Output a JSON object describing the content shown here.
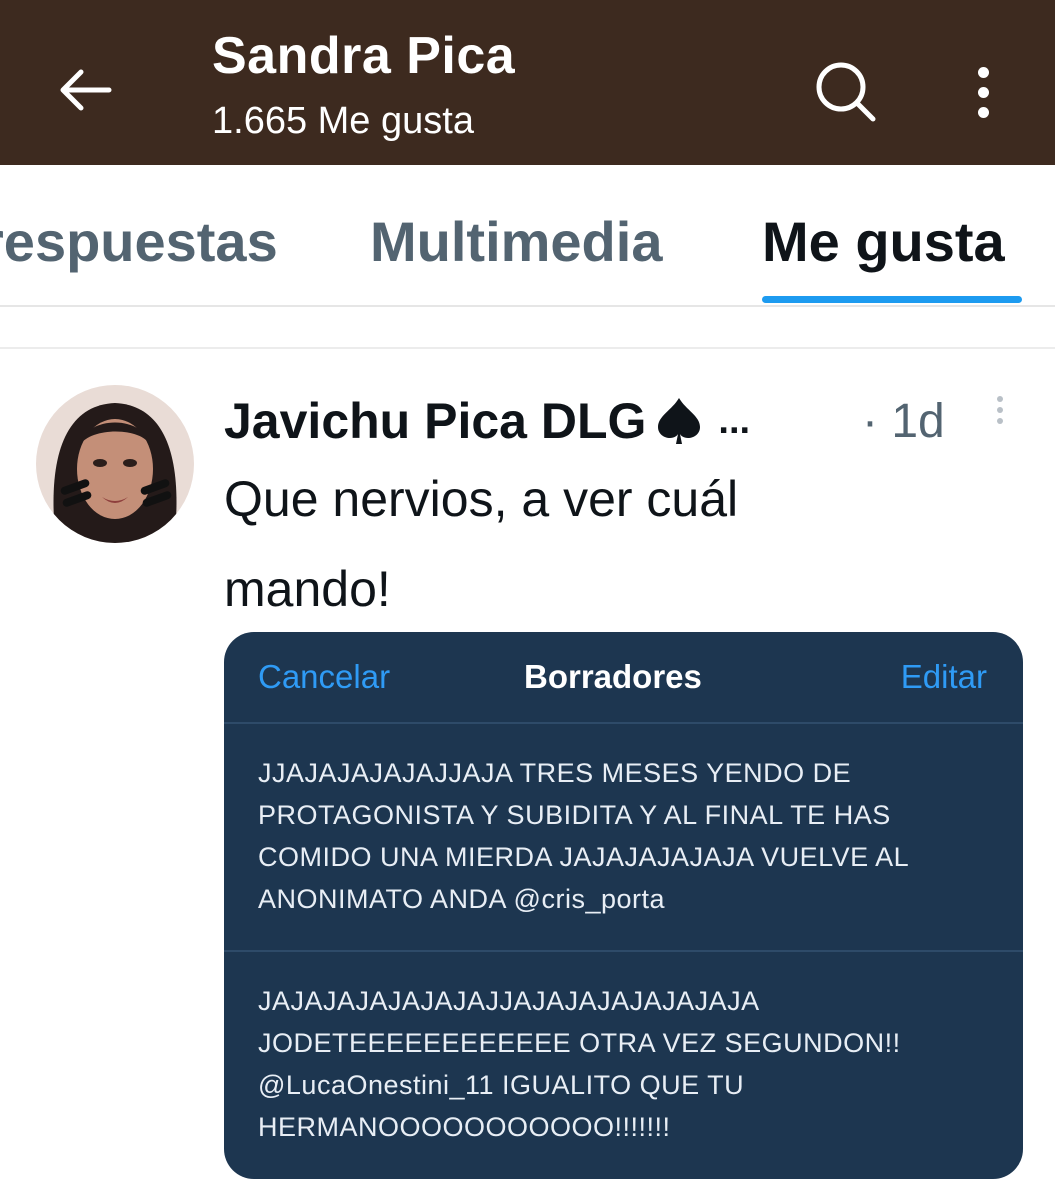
{
  "header": {
    "title": "Sandra Pica",
    "subtitle": "1.665 Me gusta",
    "background_color": "#3d2a1f",
    "icons": [
      "back-arrow-icon",
      "search-icon",
      "more-vertical-icon"
    ]
  },
  "tabs": [
    {
      "label": "respuestas",
      "selected": false
    },
    {
      "label": "Multimedia",
      "selected": false
    },
    {
      "label": "Me gusta",
      "selected": true
    }
  ],
  "accent_color": "#1d9bf0",
  "tweet": {
    "author": "Javichu Pica DLG",
    "author_badge": "spade-icon",
    "truncation": "...",
    "time": "· 1d",
    "text_lines": [
      "Que nervios, a ver cuál",
      "mando!"
    ],
    "drafts_card": {
      "cancel_label": "Cancelar",
      "title": "Borradores",
      "edit_label": "Editar",
      "drafts": [
        {
          "lines": [
            "JJAJAJAJAJAJJAJA TRES MESES YENDO DE",
            "PROTAGONISTA Y SUBIDITA Y AL FINAL TE HAS",
            "COMIDO UNA MIERDA JAJAJAJAJAJA VUELVE AL",
            "ANONIMATO ANDA @cris_porta"
          ]
        },
        {
          "lines": [
            "JAJAJAJAJAJAJAJJAJAJAJAJAJAJAJA",
            "JODETEEEEEEEEEEEE OTRA VEZ SEGUNDON!!",
            "@LucaOnestini_11 IGUALITO QUE TU",
            "HERMANOOOOOOOOOOO!!!!!!!"
          ]
        }
      ]
    }
  }
}
